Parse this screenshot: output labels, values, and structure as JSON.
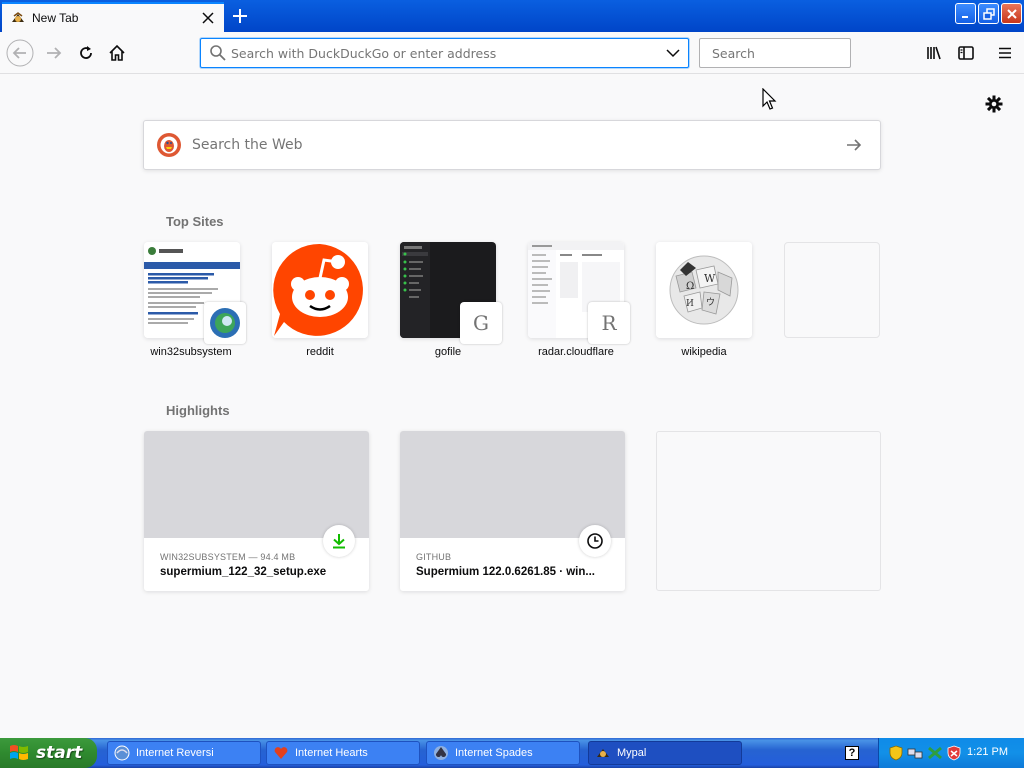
{
  "browser": {
    "tab": {
      "title": "New Tab",
      "close_glyph": "✕"
    },
    "new_tab_glyph": "+",
    "urlbar": {
      "placeholder": "Search with DuckDuckGo or enter address"
    },
    "searchbar": {
      "placeholder": "Search"
    }
  },
  "page": {
    "web_search": {
      "placeholder": "Search the Web"
    },
    "top_sites": {
      "title": "Top Sites",
      "sites": [
        {
          "label": "win32subsystem",
          "badge": ""
        },
        {
          "label": "reddit",
          "badge": ""
        },
        {
          "label": "gofile",
          "badge": "G"
        },
        {
          "label": "radar.cloudflare",
          "badge": "R"
        },
        {
          "label": "wikipedia",
          "badge": ""
        }
      ]
    },
    "highlights": {
      "title": "Highlights",
      "cards": [
        {
          "context": "WIN32SUBSYSTEM — 94.4 MB",
          "title": "supermium_122_32_setup.exe",
          "icon": "download-icon"
        },
        {
          "context": "GITHUB",
          "title": "Supermium 122.0.6261.85 · win...",
          "icon": "clock-icon"
        }
      ]
    }
  },
  "taskbar": {
    "start_label": "start",
    "items": [
      {
        "label": "Internet Reversi"
      },
      {
        "label": "Internet Hearts"
      },
      {
        "label": "Internet Spades"
      },
      {
        "label": "Mypal"
      }
    ],
    "help_glyph": "?",
    "clock": "1:21 PM"
  },
  "colors": {
    "accent": "#0a84ff",
    "titlebar": "#0045c8",
    "taskbar": "#245edb",
    "start": "#2f8a2f",
    "download": "#12bc00"
  }
}
